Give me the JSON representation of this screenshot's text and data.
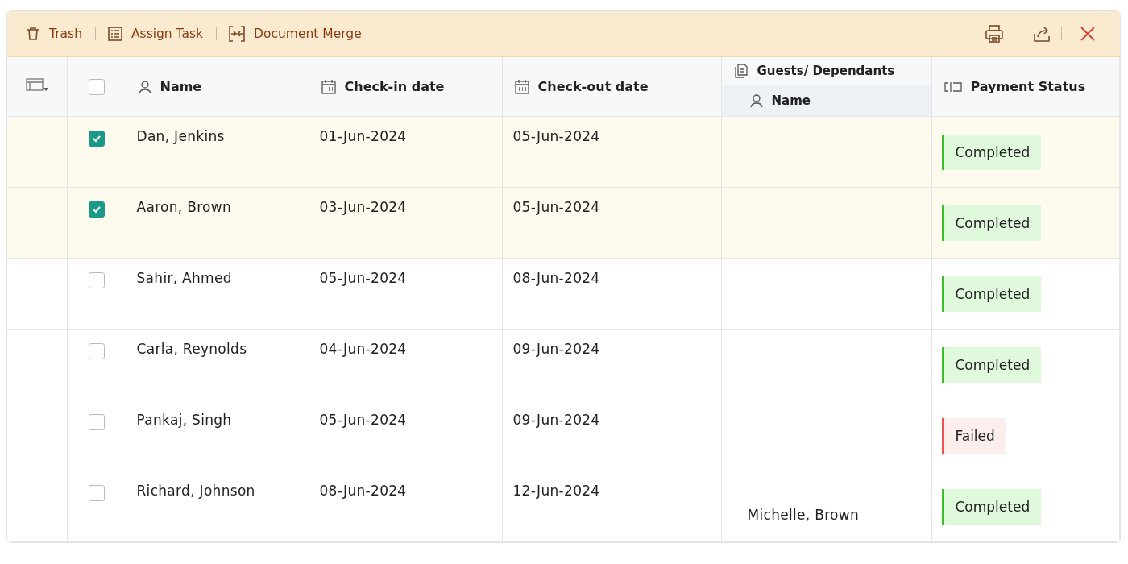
{
  "toolbar": {
    "actions": [
      {
        "label": "Trash"
      },
      {
        "label": "Assign Task"
      },
      {
        "label": "Document Merge"
      }
    ]
  },
  "table": {
    "select_all": {
      "checked": false
    },
    "columns": {
      "name": "Name",
      "checkin": "Check-in date",
      "checkout": "Check-out date",
      "group": "Guests/ Dependants",
      "group_sub": "Name",
      "status": "Payment Status"
    },
    "rows": [
      {
        "selected": true,
        "name": "Dan, Jenkins",
        "checkin": "01-Jun-2024",
        "checkout": "05-Jun-2024",
        "guest": "",
        "status": {
          "label": "Completed",
          "kind": "success"
        }
      },
      {
        "selected": true,
        "name": "Aaron, Brown",
        "checkin": "03-Jun-2024",
        "checkout": "05-Jun-2024",
        "guest": "",
        "status": {
          "label": "Completed",
          "kind": "success"
        }
      },
      {
        "selected": false,
        "name": "Sahir, Ahmed",
        "checkin": "05-Jun-2024",
        "checkout": "08-Jun-2024",
        "guest": "",
        "status": {
          "label": "Completed",
          "kind": "success"
        }
      },
      {
        "selected": false,
        "name": "Carla, Reynolds",
        "checkin": "04-Jun-2024",
        "checkout": "09-Jun-2024",
        "guest": "",
        "status": {
          "label": "Completed",
          "kind": "success"
        }
      },
      {
        "selected": false,
        "name": "Pankaj, Singh",
        "checkin": "05-Jun-2024",
        "checkout": "09-Jun-2024",
        "guest": "",
        "status": {
          "label": "Failed",
          "kind": "error"
        }
      },
      {
        "selected": false,
        "name": "Richard, Johnson",
        "checkin": "08-Jun-2024",
        "checkout": "12-Jun-2024",
        "guest": "Michelle, Brown",
        "status": {
          "label": "Completed",
          "kind": "success"
        }
      }
    ]
  }
}
